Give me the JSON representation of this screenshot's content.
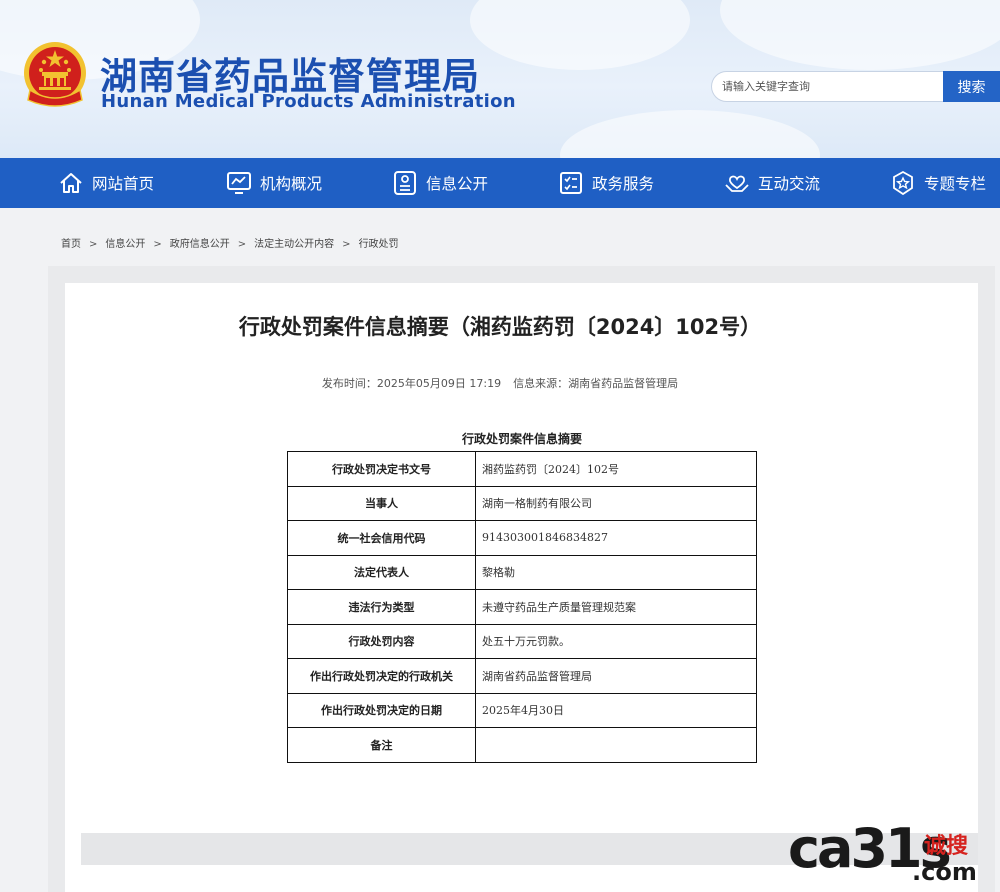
{
  "header": {
    "brand_cn": "湖南省药品监督管理局",
    "brand_en": "Hunan Medical Products Administration",
    "search_placeholder": "请输入关键字查询",
    "search_button": "搜索"
  },
  "nav": {
    "items": [
      {
        "label": "网站首页",
        "icon": "home-icon"
      },
      {
        "label": "机构概况",
        "icon": "monitor-chart-icon"
      },
      {
        "label": "信息公开",
        "icon": "document-list-icon"
      },
      {
        "label": "政务服务",
        "icon": "checklist-icon"
      },
      {
        "label": "互动交流",
        "icon": "heart-hands-icon"
      },
      {
        "label": "专题专栏",
        "icon": "star-badge-icon"
      }
    ]
  },
  "breadcrumb": [
    "首页",
    "信息公开",
    "政府信息公开",
    "法定主动公开内容",
    "行政处罚"
  ],
  "breadcrumb_separator": ">",
  "article": {
    "title": "行政处罚案件信息摘要（湘药监药罚〔2024〕102号）",
    "publish_time": "发布时间：2025年05月09日 17:19",
    "source": "信息来源：湖南省药品监督管理局",
    "table_caption": "行政处罚案件信息摘要",
    "rows": [
      {
        "key": "行政处罚决定书文号",
        "value": "湘药监药罚〔2024〕102号"
      },
      {
        "key": "当事人",
        "value": "湖南一格制药有限公司"
      },
      {
        "key": "统一社会信用代码",
        "value": "914303001846834827"
      },
      {
        "key": "法定代表人",
        "value": "黎格勒"
      },
      {
        "key": "违法行为类型",
        "value": "未遵守药品生产质量管理规范案"
      },
      {
        "key": "行政处罚内容",
        "value": "处五十万元罚款。"
      },
      {
        "key": "作出行政处罚决定的行政机关",
        "value": "湖南省药品监督管理局"
      },
      {
        "key": "作出行政处罚决定的日期",
        "value": "2025年4月30日"
      },
      {
        "key": "备注",
        "value": ""
      }
    ]
  },
  "watermark": {
    "main": "ca31s",
    "cn": "诚搜",
    "domain": ".com"
  },
  "colors": {
    "brand_blue": "#1b4fb0",
    "nav_blue": "#1f5fc4",
    "search_button": "#2464c6",
    "emblem_red": "#d0201c",
    "emblem_gold": "#f2c230",
    "watermark_red": "#d6231f"
  }
}
